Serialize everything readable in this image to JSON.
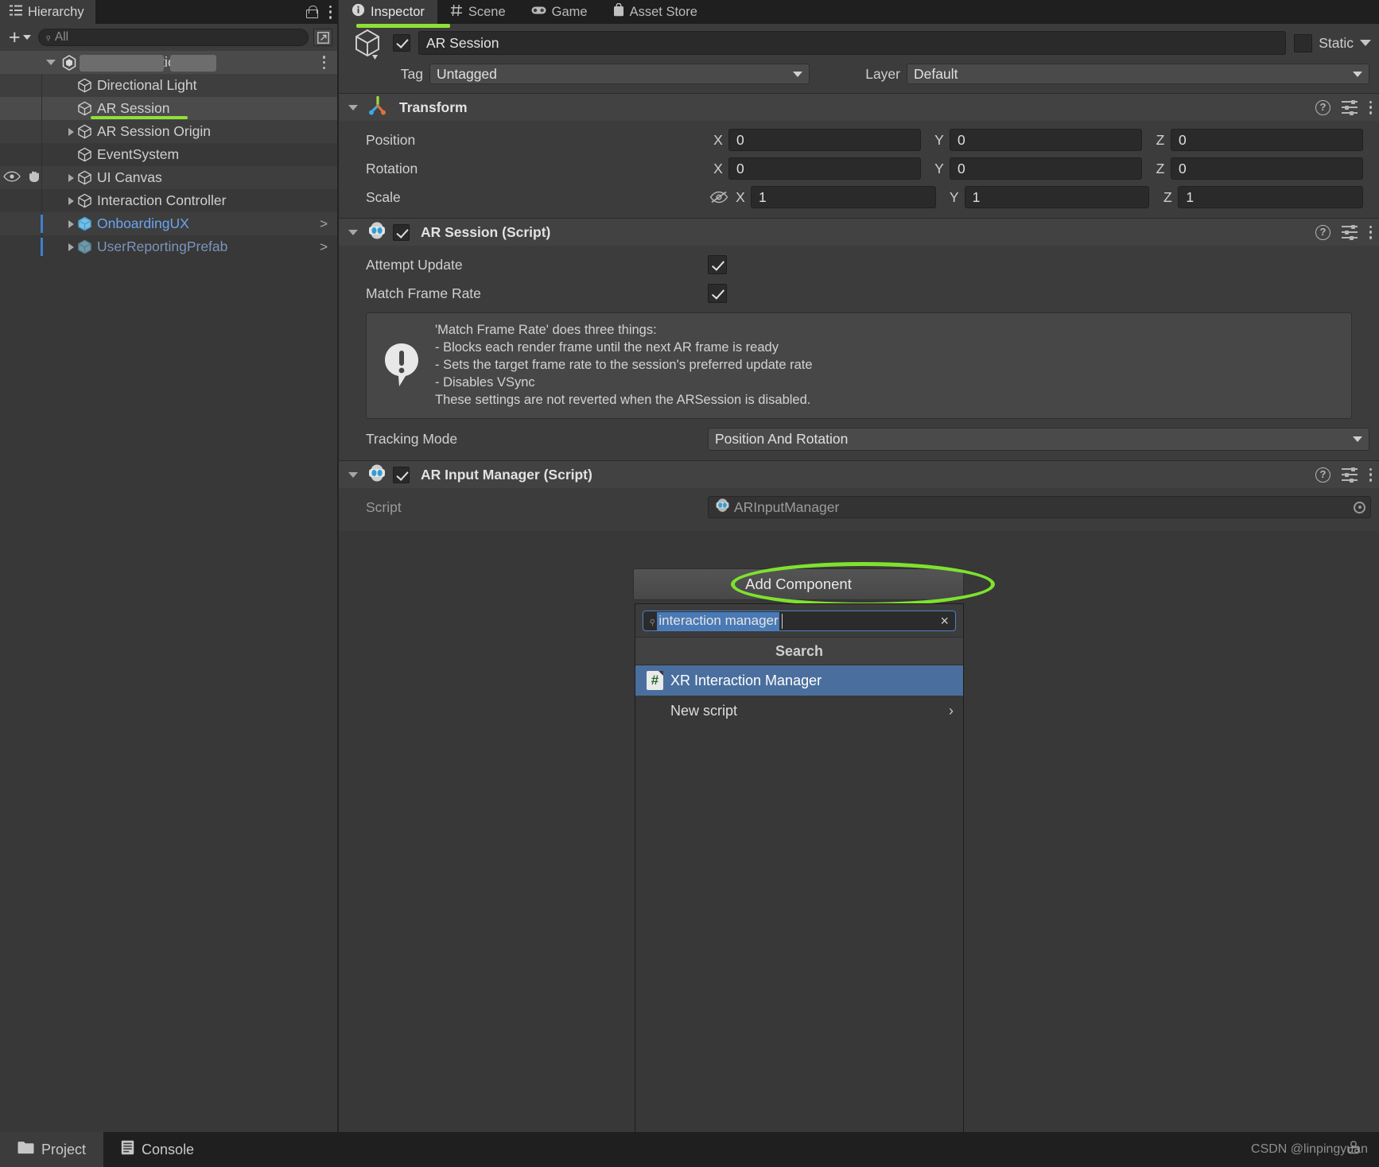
{
  "hierarchy": {
    "tab_label": "Hierarchy",
    "tab_icon": "hierarchy-icon",
    "create_label": "+",
    "search_placeholder": "All",
    "search_value": "",
    "items": [
      {
        "label": "GlobeSimulation*",
        "depth": 0,
        "foldout": "open",
        "kind": "scene",
        "redacted": true
      },
      {
        "label": "Directional Light",
        "depth": 1,
        "foldout": "none",
        "kind": "gameobject"
      },
      {
        "label": "AR Session",
        "depth": 1,
        "foldout": "none",
        "kind": "gameobject",
        "selected": true,
        "underline": true
      },
      {
        "label": "AR Session Origin",
        "depth": 1,
        "foldout": "closed",
        "kind": "gameobject"
      },
      {
        "label": "EventSystem",
        "depth": 1,
        "foldout": "none",
        "kind": "gameobject"
      },
      {
        "label": "UI Canvas",
        "depth": 1,
        "foldout": "closed",
        "kind": "gameobject",
        "vis_icons": true
      },
      {
        "label": "Interaction Controller",
        "depth": 1,
        "foldout": "closed",
        "kind": "gameobject"
      },
      {
        "label": "OnboardingUX",
        "depth": 1,
        "foldout": "closed",
        "kind": "prefab",
        "arrow": ">"
      },
      {
        "label": "UserReportingPrefab",
        "depth": 1,
        "foldout": "closed",
        "kind": "prefab-variant",
        "arrow": ">"
      }
    ]
  },
  "inspector": {
    "tabs": [
      {
        "label": "Inspector",
        "icon": "info-icon",
        "active": true
      },
      {
        "label": "Scene",
        "icon": "grid-icon",
        "active": false
      },
      {
        "label": "Game",
        "icon": "gamepad-icon",
        "active": false
      },
      {
        "label": "Asset Store",
        "icon": "store-icon",
        "active": false
      }
    ],
    "object": {
      "enabled": true,
      "name": "AR Session",
      "static_label": "Static",
      "static_checked": false,
      "tag_label": "Tag",
      "tag_value": "Untagged",
      "layer_label": "Layer",
      "layer_value": "Default"
    },
    "components": [
      {
        "title": "Transform",
        "icon": "transform-icon",
        "has_checkbox": false,
        "rows": [
          {
            "label": "Position",
            "x": "0",
            "y": "0",
            "z": "0"
          },
          {
            "label": "Rotation",
            "x": "0",
            "y": "0",
            "z": "0"
          },
          {
            "label": "Scale",
            "x": "1",
            "y": "1",
            "z": "1",
            "constrain_icon": "eye-off-icon"
          }
        ]
      },
      {
        "title": "AR Session (Script)",
        "icon": "script-icon",
        "has_checkbox": true,
        "checked": true,
        "toggles": [
          {
            "label": "Attempt Update",
            "checked": true
          },
          {
            "label": "Match Frame Rate",
            "checked": true
          }
        ],
        "helpbox": {
          "icon": "warning-icon",
          "lines": [
            "'Match Frame Rate' does three things:",
            "- Blocks each render frame until the next AR frame is ready",
            "- Sets the target frame rate to the session's preferred update rate",
            "- Disables VSync",
            "These settings are not reverted when the ARSession is disabled."
          ]
        },
        "dropdown_row": {
          "label": "Tracking Mode",
          "value": "Position And Rotation"
        }
      },
      {
        "title": "AR Input Manager (Script)",
        "icon": "script-icon",
        "has_checkbox": true,
        "checked": true,
        "script_row": {
          "label": "Script",
          "value": "ARInputManager"
        }
      }
    ]
  },
  "add_component": {
    "button_label": "Add Component",
    "highlight_color": "#7fe22e",
    "search_value": "interaction manager",
    "clear_glyph": "×",
    "section_label": "Search",
    "results": [
      {
        "label": "XR Interaction Manager",
        "icon": "csharp-script-icon",
        "selected": true
      },
      {
        "label": "New script",
        "icon": "none",
        "selected": false,
        "submenu_arrow": "›"
      }
    ]
  },
  "bottom_bar": {
    "tabs": [
      {
        "label": "Project",
        "icon": "folder-icon",
        "active": true
      },
      {
        "label": "Console",
        "icon": "console-icon",
        "active": false
      }
    ],
    "watermark": "CSDN @linpingyuan"
  },
  "colors": {
    "accent_green": "#8fe036",
    "selection_blue": "#4a6f9e",
    "panel_bg": "#383838",
    "header_bg": "#424242",
    "tabbar_bg": "#1f1f1f"
  }
}
